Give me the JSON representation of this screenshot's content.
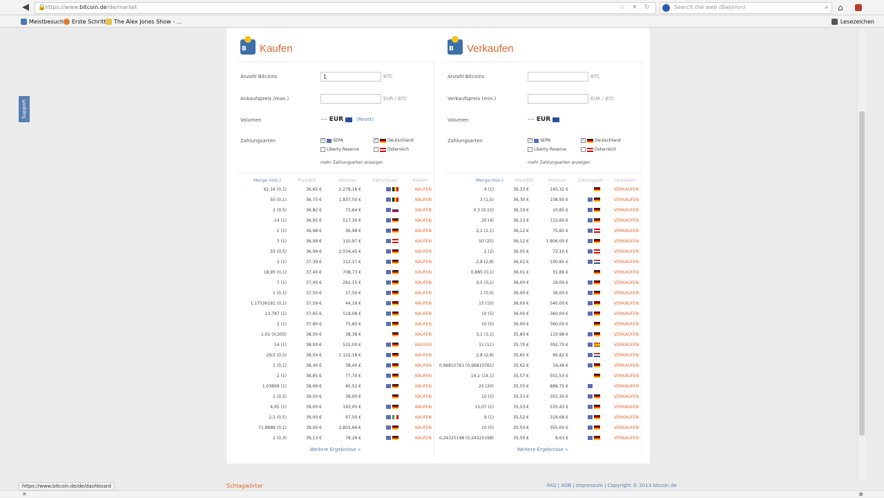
{
  "browser": {
    "url_prefix": "https://www.",
    "url_domain": "bitcoin.de",
    "url_path": "/de/market",
    "search_placeholder": "Search the web (Babylon)",
    "bookmarks": [
      "Meistbesucht",
      "Erste Schritte",
      "The Alex Jones Show - ..."
    ],
    "bookmarks_right": "Lesezeichen",
    "status_url": "https://www.bitcoin.de/de/dashboard"
  },
  "support_tab": "Support",
  "buy": {
    "title": "Kaufen",
    "label_amount": "Anzahl Bitcoins",
    "amount_value": "1",
    "unit_btc": "BTC",
    "label_price": "Ankaufspreis (max.)",
    "unit_price": "EUR / BTC",
    "label_volume": "Volumen",
    "volume_dash": "---",
    "volume_cur": "EUR",
    "reset": "(Reset)",
    "label_payment": "Zahlungsarten",
    "pay_sepa": "SEPA",
    "pay_de": "Deutschland",
    "pay_lr": "Liberty Reserve",
    "pay_at": "Österreich",
    "more_payments": "mehr Zahlungsarten anzeigen",
    "headers": [
      "Menge (min.)",
      "Preis/BTC",
      "Volumen",
      "Zahlungsart",
      "Kaufen"
    ],
    "action": "KAUFEN",
    "more_results": "Weitere Ergebnisse »",
    "rows": [
      {
        "menge": "62,16 (0,1)",
        "preis": "36,65 €",
        "vol": "2.278,16 €",
        "flag": "be"
      },
      {
        "menge": "50 (0,1)",
        "preis": "36,75 €",
        "vol": "1.837,50 €",
        "flag": "be"
      },
      {
        "menge": "2 (0,5)",
        "preis": "36,82 €",
        "vol": "73,64 €",
        "flag": "sk"
      },
      {
        "menge": "14 (1)",
        "preis": "36,95 €",
        "vol": "517,30 €",
        "flag": "de"
      },
      {
        "menge": "1 (1)",
        "preis": "36,98 €",
        "vol": "36,98 €",
        "flag": "de"
      },
      {
        "menge": "3 (1)",
        "preis": "36,99 €",
        "vol": "110,97 €",
        "flag": "at"
      },
      {
        "menge": "55 (0,5)",
        "preis": "36,99 €",
        "vol": "2.034,45 €",
        "flag": "de"
      },
      {
        "menge": "3 (1)",
        "preis": "37,39 €",
        "vol": "112,17 €",
        "flag": "de"
      },
      {
        "menge": "18,95 (0,1)",
        "preis": "37,40 €",
        "vol": "708,73 €",
        "flag": "de"
      },
      {
        "menge": "7 (1)",
        "preis": "37,45 €",
        "vol": "262,15 €",
        "flag": "de"
      },
      {
        "menge": "1 (0,1)",
        "preis": "37,50 €",
        "vol": "37,50 €",
        "flag": "de"
      },
      {
        "menge": "1,17536181 (0,1)",
        "preis": "37,59 €",
        "vol": "44,18 €",
        "flag": "de"
      },
      {
        "menge": "13,787 (1)",
        "preis": "37,65 €",
        "vol": "519,08 €",
        "flag": "de"
      },
      {
        "menge": "2 (1)",
        "preis": "37,80 €",
        "vol": "75,60 €",
        "flag": "de"
      },
      {
        "menge": "1,01 (0,505)",
        "preis": "38,00 €",
        "vol": "38,38 €",
        "flag": "de",
        "noeu": true
      },
      {
        "menge": "14 (1)",
        "preis": "38,00 €",
        "vol": "532,00 €",
        "flag": "de"
      },
      {
        "menge": "29,5 (0,5)",
        "preis": "38,04 €",
        "vol": "1.122,18 €",
        "flag": "de"
      },
      {
        "menge": "1 (0,1)",
        "preis": "38,40 €",
        "vol": "38,40 €",
        "flag": "de"
      },
      {
        "menge": "2 (1)",
        "preis": "38,85 €",
        "vol": "77,70 €",
        "flag": "de"
      },
      {
        "menge": "1,03899 (1)",
        "preis": "38,99 €",
        "vol": "40,51 €",
        "flag": "de"
      },
      {
        "menge": "1 (0,5)",
        "preis": "39,00 €",
        "vol": "39,00 €",
        "flag": "de",
        "noeu": true
      },
      {
        "menge": "4,95 (1)",
        "preis": "39,00 €",
        "vol": "193,05 €",
        "flag": "de"
      },
      {
        "menge": "2,5 (0,5)",
        "preis": "39,00 €",
        "vol": "97,50 €",
        "flag": "it"
      },
      {
        "menge": "71,8889 (0,1)",
        "preis": "39,00 €",
        "vol": "2.803,66 €",
        "flag": "de"
      },
      {
        "menge": "2 (0,3)",
        "preis": "39,13 €",
        "vol": "78,26 €",
        "flag": "de"
      }
    ]
  },
  "sell": {
    "title": "Verkaufen",
    "label_amount": "Anzahl Bitcoins",
    "amount_value": "",
    "unit_btc": "BTC",
    "label_price": "Verkaufspreis (min.)",
    "unit_price": "EUR / BTC",
    "label_volume": "Volumen",
    "volume_dash": "---",
    "volume_cur": "EUR",
    "label_payment": "Zahlungsarten",
    "pay_sepa": "SEPA",
    "pay_de": "Deutschland",
    "pay_lr": "Liberty Reserve",
    "pay_at": "Österreich",
    "more_payments": "mehr Zahlungsarten anzeigen",
    "headers": [
      "Menge (min.)",
      "Preis/BTC",
      "Volumen",
      "Zahlungsart",
      "Verkaufen"
    ],
    "action": "VERKAUFEN",
    "more_results": "Weitere Ergebnisse »",
    "rows": [
      {
        "menge": "4 (1)",
        "preis": "36,33 €",
        "vol": "145,32 €",
        "flag": "de",
        "noeu": true
      },
      {
        "menge": "3 (1,5)",
        "preis": "36,30 €",
        "vol": "108,90 €",
        "flag": "de"
      },
      {
        "menge": "0,3 (0,15)",
        "preis": "36,19 €",
        "vol": "10,85 €",
        "flag": "de"
      },
      {
        "menge": "20 (4)",
        "preis": "36,13 €",
        "vol": "722,60 €",
        "flag": "de"
      },
      {
        "menge": "2,1 (2,1)",
        "preis": "36,12 €",
        "vol": "75,85 €",
        "flag": "at"
      },
      {
        "menge": "50 (25)",
        "preis": "36,12 €",
        "vol": "1.806,00 €",
        "flag": "de"
      },
      {
        "menge": "2 (2)",
        "preis": "36,05 €",
        "vol": "72,10 €",
        "flag": "at"
      },
      {
        "menge": "2,8 (2,8)",
        "preis": "36,02 €",
        "vol": "100,85 €",
        "flag": "nl"
      },
      {
        "menge": "0,885 (0,1)",
        "preis": "36,01 €",
        "vol": "31,86 €",
        "flag": "de",
        "noeu": true
      },
      {
        "menge": "0,5 (0,1)",
        "preis": "36,00 €",
        "vol": "18,00 €",
        "flag": "de"
      },
      {
        "menge": "1 (0,5)",
        "preis": "36,00 €",
        "vol": "36,00 €",
        "flag": "de"
      },
      {
        "menge": "15 (10)",
        "preis": "36,00 €",
        "vol": "540,00 €",
        "flag": "de"
      },
      {
        "menge": "10 (5)",
        "preis": "36,00 €",
        "vol": "360,00 €",
        "flag": "de"
      },
      {
        "menge": "10 (5)",
        "preis": "36,00 €",
        "vol": "360,00 €",
        "flag": "de",
        "noeu": true
      },
      {
        "menge": "3,1 (3,1)",
        "preis": "35,80 €",
        "vol": "110,98 €",
        "flag": "de"
      },
      {
        "menge": "11 (11)",
        "preis": "35,70 €",
        "vol": "392,70 €",
        "flag": "es"
      },
      {
        "menge": "2,8 (2,8)",
        "preis": "35,65 €",
        "vol": "99,82 €",
        "flag": "nl"
      },
      {
        "menge": "0,96810761 (0,96810761)",
        "preis": "35,62 €",
        "vol": "34,48 €",
        "flag": "de"
      },
      {
        "menge": "14,1 (14,1)",
        "preis": "35,57 €",
        "vol": "501,53 €",
        "flag": "de",
        "noeu": true
      },
      {
        "menge": "25 (20)",
        "preis": "35,55 €",
        "vol": "888,75 €",
        "flag": "",
        "euonly": true
      },
      {
        "menge": "10 (5)",
        "preis": "35,53 €",
        "vol": "355,30 €",
        "flag": "de"
      },
      {
        "menge": "15,07 (1)",
        "preis": "35,53 €",
        "vol": "535,43 €",
        "flag": "de"
      },
      {
        "menge": "9 (1)",
        "preis": "35,52 €",
        "vol": "319,68 €",
        "flag": "de"
      },
      {
        "menge": "10 (5)",
        "preis": "35,50 €",
        "vol": "355,00 €",
        "flag": "de"
      },
      {
        "menge": "0,24325198 (0,24325198)",
        "preis": "35,50 €",
        "vol": "8,63 €",
        "flag": "de"
      }
    ]
  },
  "footer": {
    "tag": "Schlagwörter",
    "links": "FAQ | AGB | Impressum | Copyright © 2013 bitcoin.de"
  }
}
